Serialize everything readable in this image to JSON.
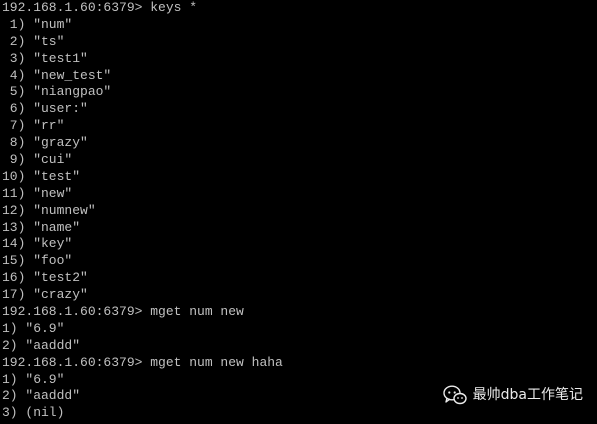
{
  "terminal": {
    "lines": [
      "192.168.1.60:6379> keys *",
      " 1) \"num\"",
      " 2) \"ts\"",
      " 3) \"test1\"",
      " 4) \"new_test\"",
      " 5) \"niangpao\"",
      " 6) \"user:\"",
      " 7) \"rr\"",
      " 8) \"grazy\"",
      " 9) \"cui\"",
      "10) \"test\"",
      "11) \"new\"",
      "12) \"numnew\"",
      "13) \"name\"",
      "14) \"key\"",
      "15) \"foo\"",
      "16) \"test2\"",
      "17) \"crazy\"",
      "192.168.1.60:6379> mget num new",
      "1) \"6.9\"",
      "2) \"aaddd\"",
      "192.168.1.60:6379> mget num new haha",
      "1) \"6.9\"",
      "2) \"aaddd\"",
      "3) (nil)"
    ]
  },
  "watermark": {
    "text": "最帅dba工作笔记",
    "icon": "wechat-bubble-icon"
  },
  "colors": {
    "background": "#000000",
    "foreground": "#c0c0c0"
  }
}
